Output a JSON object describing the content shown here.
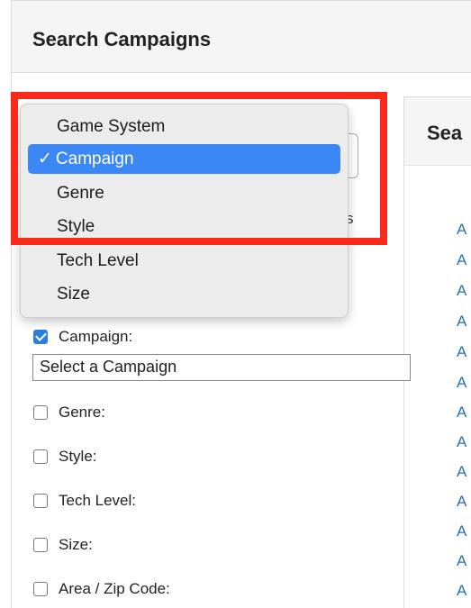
{
  "panel": {
    "title": "Search Campaigns"
  },
  "results": {
    "title": "Sea",
    "links": [
      "A",
      "A",
      "A",
      "A",
      "A",
      "A",
      "A",
      "A",
      "A",
      "A",
      "A",
      "A",
      "A"
    ]
  },
  "behind_menu": {
    "partial_text": "s"
  },
  "dropdown": {
    "options": [
      "Game System",
      "Campaign",
      "Genre",
      "Style",
      "Tech Level",
      "Size"
    ],
    "selected": "Campaign",
    "check_glyph": "✓"
  },
  "filters": {
    "campaign": {
      "label": "Campaign:",
      "checked": true,
      "select_value": "Select a Campaign"
    },
    "genre": {
      "label": "Genre:",
      "checked": false
    },
    "style": {
      "label": "Style:",
      "checked": false
    },
    "tech_level": {
      "label": "Tech Level:",
      "checked": false
    },
    "size": {
      "label": "Size:",
      "checked": false
    },
    "area": {
      "label": "Area / Zip Code:",
      "checked": false
    }
  },
  "colors": {
    "highlight": "#fa2a1a",
    "selected": "#3a87f5",
    "link": "#2a6fb5"
  }
}
